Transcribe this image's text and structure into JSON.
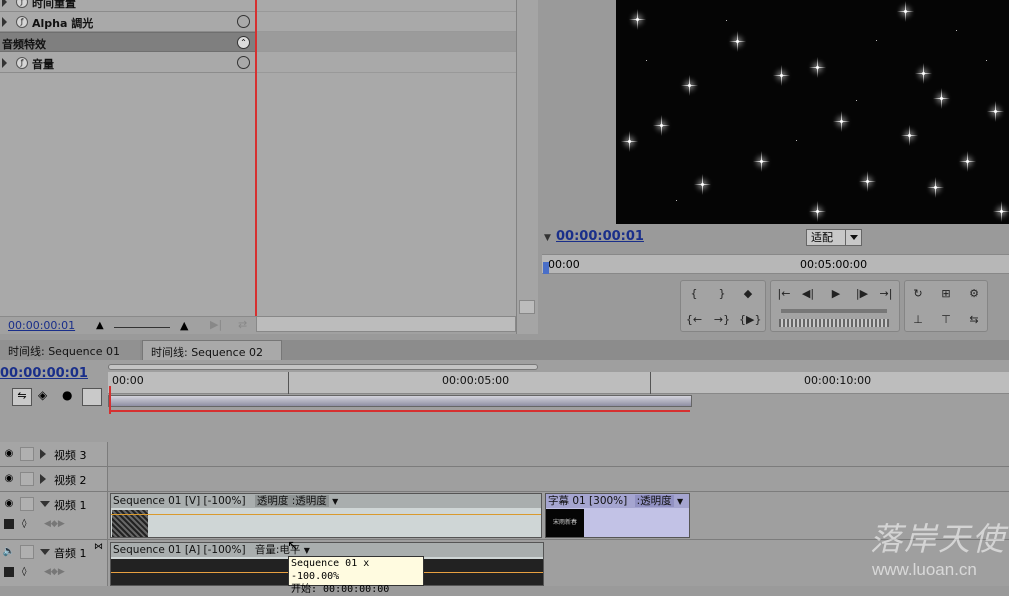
{
  "effect_controls": {
    "rows": [
      {
        "label": "时间重置",
        "has_reset": false
      },
      {
        "label": "Alpha 調光",
        "has_reset": true
      }
    ],
    "audio_section": "音频特效",
    "audio_rows": [
      {
        "label": "音量",
        "has_reset": true
      }
    ],
    "timecode": "00:00:00:01"
  },
  "monitor": {
    "timecode": "00:00:00:01",
    "fit_select": "适配",
    "ruler": [
      "00:00",
      "00:05:00:00"
    ]
  },
  "tabs": [
    {
      "label": "时间线: Sequence 01",
      "active": false
    },
    {
      "label": "时间线: Sequence 02",
      "active": true,
      "close": "×"
    }
  ],
  "timeline": {
    "timecode": "00:00:00:01",
    "ruler": [
      "00:00",
      "00:00:05:00",
      "00:00:10:00"
    ],
    "tracks": [
      {
        "name": "视频 3",
        "type": "video"
      },
      {
        "name": "视频 2",
        "type": "video"
      },
      {
        "name": "视频 1",
        "type": "video"
      },
      {
        "name": "音频 1",
        "type": "audio"
      }
    ],
    "clips": {
      "v1_seq": "Sequence 01 [V] [-100%]",
      "v1_seq_prop": "透明度 :透明度",
      "v1_title": "字幕 01 [300%]",
      "v1_title_prop": ":透明度",
      "v1_title_thumb": "宋雨新春",
      "a1_seq": "Sequence 01 [A] [-100%]",
      "a1_seq_prop": "音量:电平"
    },
    "tooltip": {
      "line1": "Sequence 01 x -100.00%",
      "line2": "开始: 00:00:00:00"
    }
  },
  "watermark": {
    "text": "落岸天使",
    "url": "www.luoan.cn"
  },
  "colors": {
    "playhead": "#d63030",
    "timecode": "#1a2f8a"
  }
}
